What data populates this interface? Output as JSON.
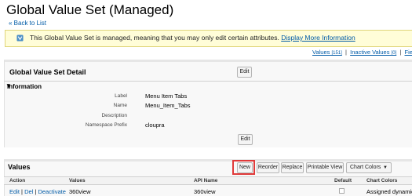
{
  "page": {
    "title": "Global Value Set (Managed)",
    "back_link": "« Back to List"
  },
  "notice": {
    "text": "This Global Value Set is managed, meaning that you may only edit certain attributes.",
    "link": "Display More Information",
    "icon": "info-icon"
  },
  "top_links": {
    "values_label": "Values",
    "values_count": "[151]",
    "inactive_label": "Inactive Values",
    "inactive_count": "[0]",
    "field_label": "Field"
  },
  "detail": {
    "title": "Global Value Set Detail",
    "edit_label": "Edit",
    "section": "Information",
    "fields": [
      {
        "label": "Label",
        "value": "Menu Item Tabs"
      },
      {
        "label": "Name",
        "value": "Menu_Item_Tabs"
      },
      {
        "label": "Description",
        "value": ""
      },
      {
        "label": "Namespace Prefix",
        "value": "cloupra"
      }
    ],
    "edit_bottom_label": "Edit"
  },
  "values": {
    "title": "Values",
    "buttons": {
      "new": "New",
      "reorder": "Reorder",
      "replace": "Replace",
      "printable_view": "Printable View",
      "chart_colors": "Chart Colors"
    },
    "columns": [
      "Action",
      "Values",
      "API Name",
      "Default",
      "Chart Colors"
    ],
    "rows": [
      {
        "actions": [
          "Edit",
          "Del",
          "Deactivate"
        ],
        "value": "360view",
        "api_name": "360view",
        "default": false,
        "chart_color": "Assigned dynamic"
      }
    ]
  },
  "colors": {
    "link": "#015ba7",
    "notice_bg": "#fffdd8",
    "highlight": "#e03a3a"
  }
}
